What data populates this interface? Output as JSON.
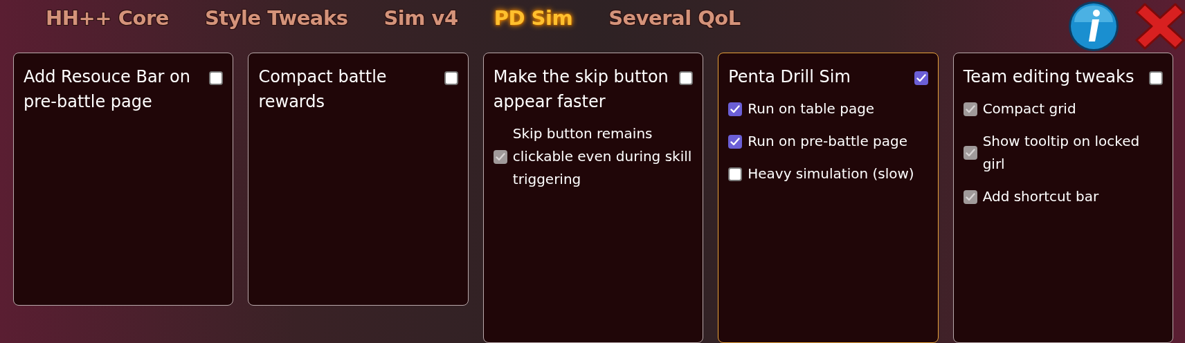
{
  "tabs": [
    {
      "label": "HH++ Core",
      "selected": false
    },
    {
      "label": "Style Tweaks",
      "selected": false
    },
    {
      "label": "Sim v4",
      "selected": false
    },
    {
      "label": "PD Sim",
      "selected": true
    },
    {
      "label": "Several QoL",
      "selected": false
    }
  ],
  "cards": [
    {
      "title": "Add Resouce Bar on pre-battle page",
      "checked": false,
      "highlighted": false
    },
    {
      "title": "Compact battle rewards",
      "checked": false,
      "highlighted": false
    },
    {
      "title": "Make the skip button appear faster",
      "checked": false,
      "highlighted": false,
      "options": [
        {
          "label": "Skip button remains clickable even during skill triggering",
          "checked": true,
          "disabled": true
        }
      ]
    },
    {
      "title": "Penta Drill Sim",
      "checked": true,
      "highlighted": true,
      "options": [
        {
          "label": "Run on table page",
          "checked": true,
          "disabled": false
        },
        {
          "label": "Run on pre-battle page",
          "checked": true,
          "disabled": false
        },
        {
          "label": "Heavy simulation (slow)",
          "checked": false,
          "disabled": false
        }
      ]
    },
    {
      "title": "Team editing tweaks",
      "checked": false,
      "highlighted": false,
      "options": [
        {
          "label": "Compact grid",
          "checked": true,
          "disabled": true
        },
        {
          "label": "Show tooltip on locked girl",
          "checked": true,
          "disabled": true
        },
        {
          "label": "Add shortcut bar",
          "checked": true,
          "disabled": true
        }
      ]
    }
  ]
}
